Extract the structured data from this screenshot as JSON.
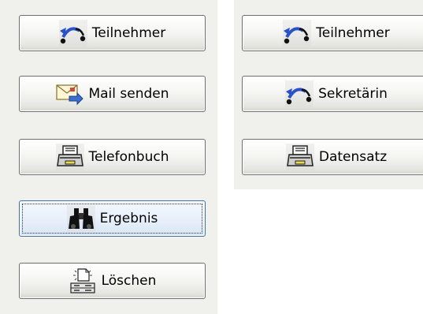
{
  "left_column": {
    "teilnehmer": {
      "label": "Teilnehmer",
      "icon": "call-transfer-icon"
    },
    "mail_senden": {
      "label": "Mail senden",
      "icon": "mail-send-icon"
    },
    "telefonbuch": {
      "label": "Telefonbuch",
      "icon": "phonebook-icon"
    },
    "ergebnis": {
      "label": "Ergebnis",
      "icon": "binoculars-icon",
      "focused": true
    },
    "loeschen": {
      "label": "Löschen",
      "icon": "delete-icon"
    }
  },
  "right_column": {
    "teilnehmer": {
      "label": "Teilnehmer",
      "icon": "call-transfer-icon"
    },
    "sekretaerin": {
      "label": "Sekretärin",
      "icon": "call-transfer-icon"
    },
    "datensatz": {
      "label": "Datensatz",
      "icon": "phonebook-icon"
    }
  },
  "colors": {
    "panel_background": "#f0f0ec",
    "button_border": "#6f6f6f",
    "focus_border": "#3d6fa8",
    "arrow_blue": "#2a52c8"
  }
}
